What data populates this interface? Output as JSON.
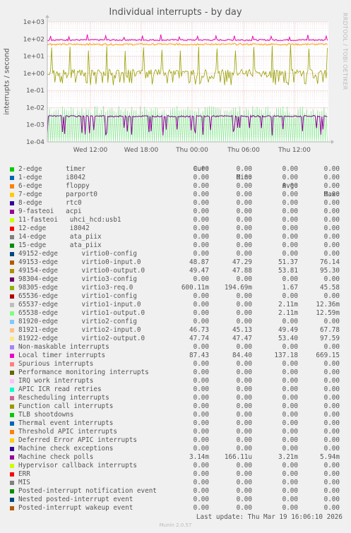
{
  "title": "Individual interrupts - by day",
  "ylabel": "interrupts / second",
  "watermark": "RRDTOOL / TOBI OETIKER",
  "footer": "Munin 2.0.57",
  "last_update": "Last update: Thu Mar 19 16:06:10 2026",
  "legend_headers": {
    "cur": "Cur:",
    "min": "Min:",
    "avg": "Avg:",
    "max": "Max:"
  },
  "chart_data": {
    "type": "line",
    "title": "Individual interrupts - by day",
    "ylabel": "interrupts / second",
    "yscale": "log",
    "ylim": [
      0.0001,
      1000
    ],
    "y_ticks": [
      "1e-04",
      "1e-03",
      "1e-02",
      "1e-01",
      "1e+00",
      "1e+01",
      "1e+02",
      "1e+03"
    ],
    "x_ticks": [
      "Wed 12:00",
      "Wed 18:00",
      "Thu 00:00",
      "Thu 06:00",
      "Thu 12:00"
    ],
    "grid": true,
    "series": [
      {
        "name": "Local timer interrupts",
        "color": "#e60ebb",
        "base": 87.43,
        "low": 84.4,
        "spike": 137.18
      },
      {
        "name": "Posted-interrupt notification event",
        "color": "#fe9900",
        "base": 49.0,
        "low": 47.3,
        "spike": 53.8
      },
      {
        "name": "98305-edge virtio3-req.0",
        "color": "#98a100",
        "base": 1.0,
        "low": 0.25,
        "spike": 45.58
      },
      {
        "name": "Machine check polls",
        "color": "#8c0097",
        "base": 0.00314,
        "low": 0.00017,
        "spike": 0.0059
      },
      {
        "name": "65538-edge virtio1-output.0",
        "color": "#8fe99a",
        "base": 0.0001,
        "low": 0.0001,
        "spike": 0.0126
      }
    ]
  },
  "legend": [
    {
      "name": "2-edge      timer",
      "color": "#00cc00",
      "cur": "0.00",
      "min": "0.00",
      "avg": "0.00",
      "max": "0.00"
    },
    {
      "name": "1-edge      i8042",
      "color": "#0066b3",
      "cur": "0.00",
      "min": "0.00",
      "avg": "0.00",
      "max": "0.00"
    },
    {
      "name": "6-edge      floppy",
      "color": "#ff8000",
      "cur": "0.00",
      "min": "0.00",
      "avg": "0.00",
      "max": "0.00"
    },
    {
      "name": "7-edge      parport0",
      "color": "#ffcc00",
      "cur": "0.00",
      "min": "0.00",
      "avg": "0.00",
      "max": "0.00"
    },
    {
      "name": "8-edge      rtc0",
      "color": "#330099",
      "cur": "0.00",
      "min": "0.00",
      "avg": "0.00",
      "max": "0.00"
    },
    {
      "name": "9-fasteoi   acpi",
      "color": "#990099",
      "cur": "0.00",
      "min": "0.00",
      "avg": "0.00",
      "max": "0.00"
    },
    {
      "name": "11-fasteoi   uhci_hcd:usb1",
      "color": "#ccff00",
      "cur": "0.00",
      "min": "0.00",
      "avg": "0.00",
      "max": "0.00"
    },
    {
      "name": "12-edge      i8042",
      "color": "#ff0000",
      "cur": "0.00",
      "min": "0.00",
      "avg": "0.00",
      "max": "0.00"
    },
    {
      "name": "14-edge      ata_piix",
      "color": "#808080",
      "cur": "0.00",
      "min": "0.00",
      "avg": "0.00",
      "max": "0.00"
    },
    {
      "name": "15-edge      ata_piix",
      "color": "#008f00",
      "cur": "0.00",
      "min": "0.00",
      "avg": "0.00",
      "max": "0.00"
    },
    {
      "name": "49152-edge      virtio0-config",
      "color": "#00487d",
      "cur": "0.00",
      "min": "0.00",
      "avg": "0.00",
      "max": "0.00"
    },
    {
      "name": "49153-edge      virtio0-input.0",
      "color": "#b35a00",
      "cur": "48.87",
      "min": "47.29",
      "avg": "51.37",
      "max": "76.14"
    },
    {
      "name": "49154-edge      virtio0-output.0",
      "color": "#b38f00",
      "cur": "49.47",
      "min": "47.88",
      "avg": "53.81",
      "max": "95.30"
    },
    {
      "name": "98304-edge      virtio3-config",
      "color": "#6b006b",
      "cur": "0.00",
      "min": "0.00",
      "avg": "0.00",
      "max": "0.00"
    },
    {
      "name": "98305-edge      virtio3-req.0",
      "color": "#8fb300",
      "cur": "600.11m",
      "min": "194.69m",
      "avg": "1.67",
      "max": "45.58"
    },
    {
      "name": "65536-edge      virtio1-config",
      "color": "#b30000",
      "cur": "0.00",
      "min": "0.00",
      "avg": "0.00",
      "max": "0.00"
    },
    {
      "name": "65537-edge      virtio1-input.0",
      "color": "#bebebe",
      "cur": "0.00",
      "min": "0.00",
      "avg": "2.11m",
      "max": "12.36m"
    },
    {
      "name": "65538-edge      virtio1-output.0",
      "color": "#80ff80",
      "cur": "0.00",
      "min": "0.00",
      "avg": "2.11m",
      "max": "12.59m"
    },
    {
      "name": "81920-edge      virtio2-config",
      "color": "#80c9ff",
      "cur": "0.00",
      "min": "0.00",
      "avg": "0.00",
      "max": "0.00"
    },
    {
      "name": "81921-edge      virtio2-input.0",
      "color": "#ffc080",
      "cur": "46.73",
      "min": "45.13",
      "avg": "49.49",
      "max": "67.78"
    },
    {
      "name": "81922-edge      virtio2-output.0",
      "color": "#ffe680",
      "cur": "47.74",
      "min": "47.47",
      "avg": "53.40",
      "max": "97.59"
    },
    {
      "name": "Non-maskable interrupts",
      "color": "#aa80ff",
      "cur": "0.00",
      "min": "0.00",
      "avg": "0.00",
      "max": "0.00"
    },
    {
      "name": "Local timer interrupts",
      "color": "#ee00cc",
      "cur": "87.43",
      "min": "84.40",
      "avg": "137.18",
      "max": "669.15"
    },
    {
      "name": "Spurious interrupts",
      "color": "#ff8080",
      "cur": "0.00",
      "min": "0.00",
      "avg": "0.00",
      "max": "0.00"
    },
    {
      "name": "Performance monitoring interrupts",
      "color": "#666600",
      "cur": "0.00",
      "min": "0.00",
      "avg": "0.00",
      "max": "0.00"
    },
    {
      "name": "IRQ work interrupts",
      "color": "#ffbfff",
      "cur": "0.00",
      "min": "0.00",
      "avg": "0.00",
      "max": "0.00"
    },
    {
      "name": "APIC ICR read retries",
      "color": "#00ffcc",
      "cur": "0.00",
      "min": "0.00",
      "avg": "0.00",
      "max": "0.00"
    },
    {
      "name": "Rescheduling interrupts",
      "color": "#cc6699",
      "cur": "0.00",
      "min": "0.00",
      "avg": "0.00",
      "max": "0.00"
    },
    {
      "name": "Function call interrupts",
      "color": "#999900",
      "cur": "0.00",
      "min": "0.00",
      "avg": "0.00",
      "max": "0.00"
    },
    {
      "name": "TLB shootdowns",
      "color": "#00cc00",
      "cur": "0.00",
      "min": "0.00",
      "avg": "0.00",
      "max": "0.00"
    },
    {
      "name": "Thermal event interrupts",
      "color": "#0066b3",
      "cur": "0.00",
      "min": "0.00",
      "avg": "0.00",
      "max": "0.00"
    },
    {
      "name": "Threshold APIC interrupts",
      "color": "#ff8000",
      "cur": "0.00",
      "min": "0.00",
      "avg": "0.00",
      "max": "0.00"
    },
    {
      "name": "Deferred Error APIC interrupts",
      "color": "#ffcc00",
      "cur": "0.00",
      "min": "0.00",
      "avg": "0.00",
      "max": "0.00"
    },
    {
      "name": "Machine check exceptions",
      "color": "#330099",
      "cur": "0.00",
      "min": "0.00",
      "avg": "0.00",
      "max": "0.00"
    },
    {
      "name": "Machine check polls",
      "color": "#990099",
      "cur": "3.14m",
      "min": "166.11u",
      "avg": "3.21m",
      "max": "5.94m"
    },
    {
      "name": "Hypervisor callback interrupts",
      "color": "#ccff00",
      "cur": "0.00",
      "min": "0.00",
      "avg": "0.00",
      "max": "0.00"
    },
    {
      "name": "ERR",
      "color": "#ff0000",
      "cur": "0.00",
      "min": "0.00",
      "avg": "0.00",
      "max": "0.00"
    },
    {
      "name": "MIS",
      "color": "#808080",
      "cur": "0.00",
      "min": "0.00",
      "avg": "0.00",
      "max": "0.00"
    },
    {
      "name": "Posted-interrupt notification event",
      "color": "#008f00",
      "cur": "0.00",
      "min": "0.00",
      "avg": "0.00",
      "max": "0.00"
    },
    {
      "name": "Nested posted-interrupt event",
      "color": "#00487d",
      "cur": "0.00",
      "min": "0.00",
      "avg": "0.00",
      "max": "0.00"
    },
    {
      "name": "Posted-interrupt wakeup event",
      "color": "#b35a00",
      "cur": "0.00",
      "min": "0.00",
      "avg": "0.00",
      "max": "0.00"
    }
  ]
}
